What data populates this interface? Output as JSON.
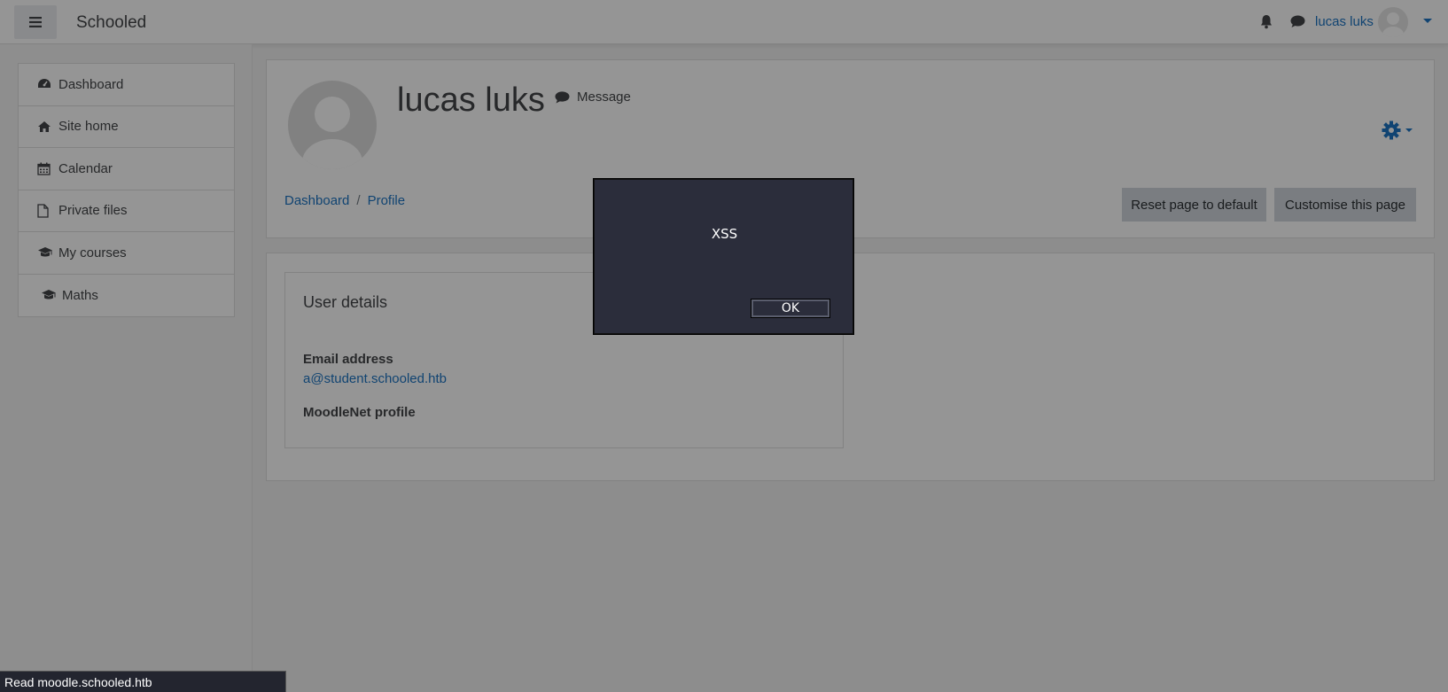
{
  "navbar": {
    "site_name": "Schooled",
    "user_name": "lucas luks",
    "icons": [
      "menu-icon",
      "bell-icon",
      "chat-icon",
      "avatar-icon",
      "caret-down-icon"
    ]
  },
  "drawer": {
    "items": [
      {
        "label": "Dashboard",
        "icon": "dashboard-icon"
      },
      {
        "label": "Site home",
        "icon": "home-icon"
      },
      {
        "label": "Calendar",
        "icon": "calendar-icon"
      },
      {
        "label": "Private files",
        "icon": "file-icon"
      },
      {
        "label": "My courses",
        "icon": "graduation-cap-icon"
      },
      {
        "label": "Maths",
        "icon": "graduation-cap-icon"
      }
    ]
  },
  "header": {
    "profile_name": "lucas luks",
    "message_label": "Message",
    "breadcrumb": [
      "Dashboard",
      "Profile"
    ],
    "breadcrumb_sep": "/",
    "reset_label": "Reset page to default",
    "customise_label": "Customise this page"
  },
  "user_details": {
    "title": "User details",
    "email_label": "Email address",
    "email_value": "a@student.schooled.htb",
    "moodlenet_label": "MoodleNet profile"
  },
  "dialog": {
    "message": "XSS",
    "ok_label": "OK"
  },
  "statusbar": {
    "text": "Read moodle.schooled.htb"
  },
  "colors": {
    "link": "#0f6cbf",
    "dialog_bg": "#2b2d3b",
    "button_bg": "#ced4da"
  }
}
